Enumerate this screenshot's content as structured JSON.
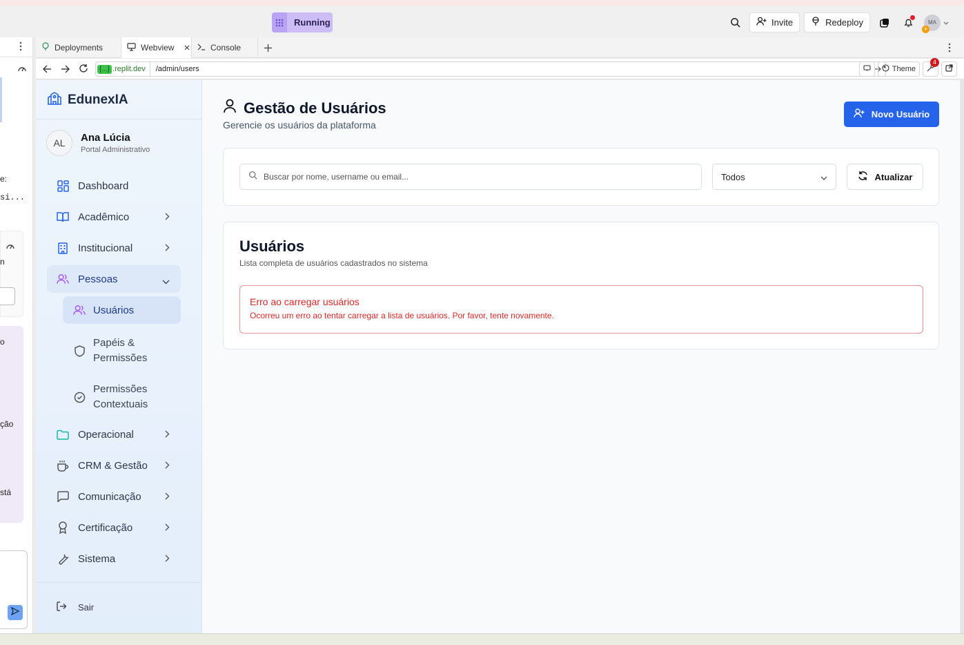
{
  "replit": {
    "status_label": "Running",
    "invite_label": "Invite",
    "redeploy_label": "Redeploy",
    "avatar_initials": "MA",
    "avatar_plus": "+",
    "tabs": [
      {
        "label": "Deployments",
        "icon": "tree-icon"
      },
      {
        "label": "Webview",
        "icon": "monitor-icon"
      },
      {
        "label": "Console",
        "icon": "terminal-icon"
      }
    ],
    "url_badge": "{...}",
    "url_host": ".replit.dev",
    "url_path": "/admin/users",
    "theme_label": "Theme",
    "devtools_badge": "4"
  },
  "left_panel": {
    "snippets": [
      "e:",
      "si...",
      "n",
      "o",
      "ção",
      "stá"
    ]
  },
  "sidebar": {
    "brand": "EdunexIA",
    "user": {
      "initials": "AL",
      "name": "Ana Lúcia",
      "role": "Portal Administrativo"
    },
    "nav": [
      {
        "label": "Dashboard"
      },
      {
        "label": "Acadêmico"
      },
      {
        "label": "Institucional"
      },
      {
        "label": "Pessoas"
      },
      {
        "label": "Operacional"
      },
      {
        "label": "CRM & Gestão"
      },
      {
        "label": "Comunicação"
      },
      {
        "label": "Certificação"
      },
      {
        "label": "Sistema"
      }
    ],
    "sub": [
      {
        "label": "Usuários"
      },
      {
        "line1": "Papéis &",
        "line2": "Permissões"
      },
      {
        "line1": "Permissões",
        "line2": "Contextuais"
      }
    ],
    "logout": "Sair"
  },
  "main": {
    "title": "Gestão de Usuários",
    "subtitle": "Gerencie os usuários da plataforma",
    "new_user_label": "Novo Usuário",
    "search_placeholder": "Buscar por nome, username ou email...",
    "filter_value": "Todos",
    "refresh_label": "Atualizar",
    "list_title": "Usuários",
    "list_subtitle": "Lista completa de usuários cadastrados no sistema",
    "error_title": "Erro ao carregar usuários",
    "error_message": "Ocorreu um erro ao tentar carregar a lista de usuários. Por favor, tente novamente."
  },
  "colors": {
    "primary": "#2563eb",
    "error": "#dc2626",
    "running_badge": "#cdbdf6"
  }
}
